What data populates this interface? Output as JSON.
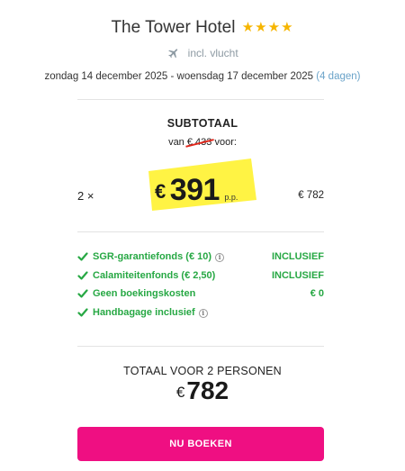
{
  "hotel": {
    "name": "The Tower Hotel",
    "stars": "★★★★"
  },
  "flight": {
    "icon": "plane-icon",
    "label": "incl. vlucht"
  },
  "dates": {
    "range": "zondag 14 december 2025 - woensdag 17 december 2025",
    "duration": "(4 dagen)"
  },
  "subtotal": {
    "title": "SUBTOTAAL",
    "van_prefix": "van",
    "old_price": "€ 433",
    "van_suffix": "voor:",
    "quantity": "2 ×",
    "currency": "€",
    "price": "391",
    "per_person": "p.p.",
    "line_total": "€ 782"
  },
  "features": [
    {
      "label": "SGR-garantiefonds (€ 10)",
      "info": true,
      "value": "INCLUSIEF"
    },
    {
      "label": "Calamiteitenfonds (€ 2,50)",
      "info": false,
      "value": "INCLUSIEF"
    },
    {
      "label": "Geen boekingskosten",
      "info": false,
      "value": "€ 0"
    },
    {
      "label": "Handbagage inclusief",
      "info": true,
      "value": ""
    }
  ],
  "total": {
    "title": "TOTAAL VOOR 2 PERSONEN",
    "currency": "€",
    "amount": "782"
  },
  "cta": {
    "label": "NU BOEKEN"
  },
  "colors": {
    "accent": "#ef0f82",
    "success": "#27a844",
    "highlight": "#fff23a",
    "stars": "#f6b500",
    "strike": "#e0251a"
  }
}
